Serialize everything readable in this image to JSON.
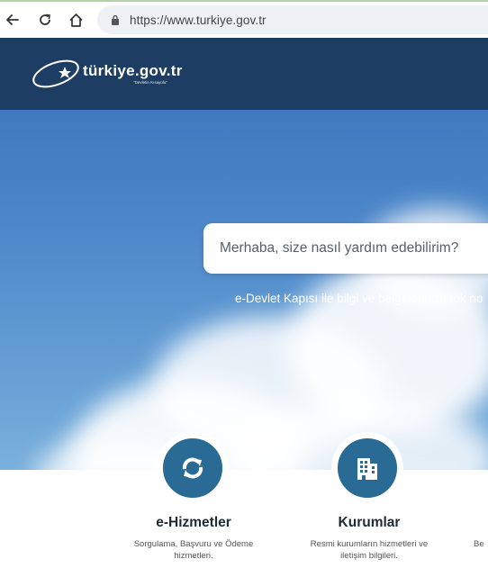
{
  "browser": {
    "url": "https://www.turkiye.gov.tr"
  },
  "header": {
    "logo_text": "türkiye.gov.tr",
    "logo_subtext": "\"Devletin Kısayolu\""
  },
  "hero": {
    "search_placeholder": "Merhaba, size nasıl yardım edebilirim?",
    "tagline": "e-Devlet Kapısı ile bilgi ve belgelerinize tek no"
  },
  "services": [
    {
      "title": "e-Hizmetler",
      "desc_line1": "Sorgulama, Başvuru ve Ödeme",
      "desc_line2": "hizmetleri.",
      "icon": "refresh-icon"
    },
    {
      "title": "Kurumlar",
      "desc_line1": "Resmi kurumların hizmetleri ve",
      "desc_line2": "iletişim bilgileri.",
      "icon": "building-icon"
    },
    {
      "desc_partial": "Be"
    }
  ],
  "colors": {
    "header_bg": "#1d3d62",
    "sky": "#4b86c8",
    "icon_circle": "#2a6b96"
  }
}
